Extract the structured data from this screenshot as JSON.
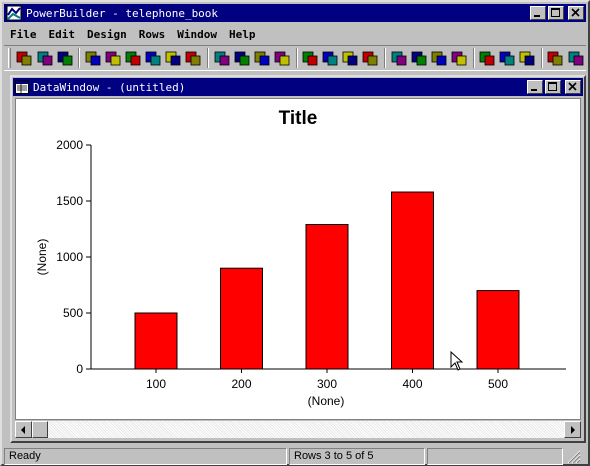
{
  "window": {
    "title": "PowerBuilder - telephone_book"
  },
  "menu": [
    "File",
    "Edit",
    "Design",
    "Rows",
    "Window",
    "Help"
  ],
  "toolbar": {
    "buttons": [
      "new-icon",
      "open-icon",
      "library-icon",
      "database-icon",
      "structure-icon",
      "preview-icon",
      "application-icon",
      "query-icon",
      "data-pipeline-icon",
      "report-icon",
      "debug-icon",
      "run-icon",
      "table-icon",
      "user-objects-icon",
      "db-profile-icon",
      "data-window-icon",
      "function-icon",
      "chart-icon",
      "query-painter-icon",
      "printer-icon",
      "bank-icon",
      "edit-icon",
      "color-icon",
      "exit-run-icon",
      "stop-icon",
      "menu-icon"
    ]
  },
  "datawindow": {
    "title": "DataWindow - (untitled)"
  },
  "status": {
    "left": "Ready",
    "rows": "Rows 3 to 5 of 5",
    "right": ""
  },
  "colors": {
    "bar": "#ff0000",
    "title_bar": "#000080"
  },
  "chart_data": {
    "type": "bar",
    "title": "Title",
    "xlabel": "(None)",
    "ylabel": "(None)",
    "categories": [
      "100",
      "200",
      "300",
      "400",
      "500"
    ],
    "values": [
      500,
      900,
      1290,
      1580,
      700
    ],
    "ylim": [
      0,
      2000
    ],
    "yticks": [
      0,
      500,
      1000,
      1500,
      2000
    ],
    "legend": "none",
    "grid": false
  }
}
